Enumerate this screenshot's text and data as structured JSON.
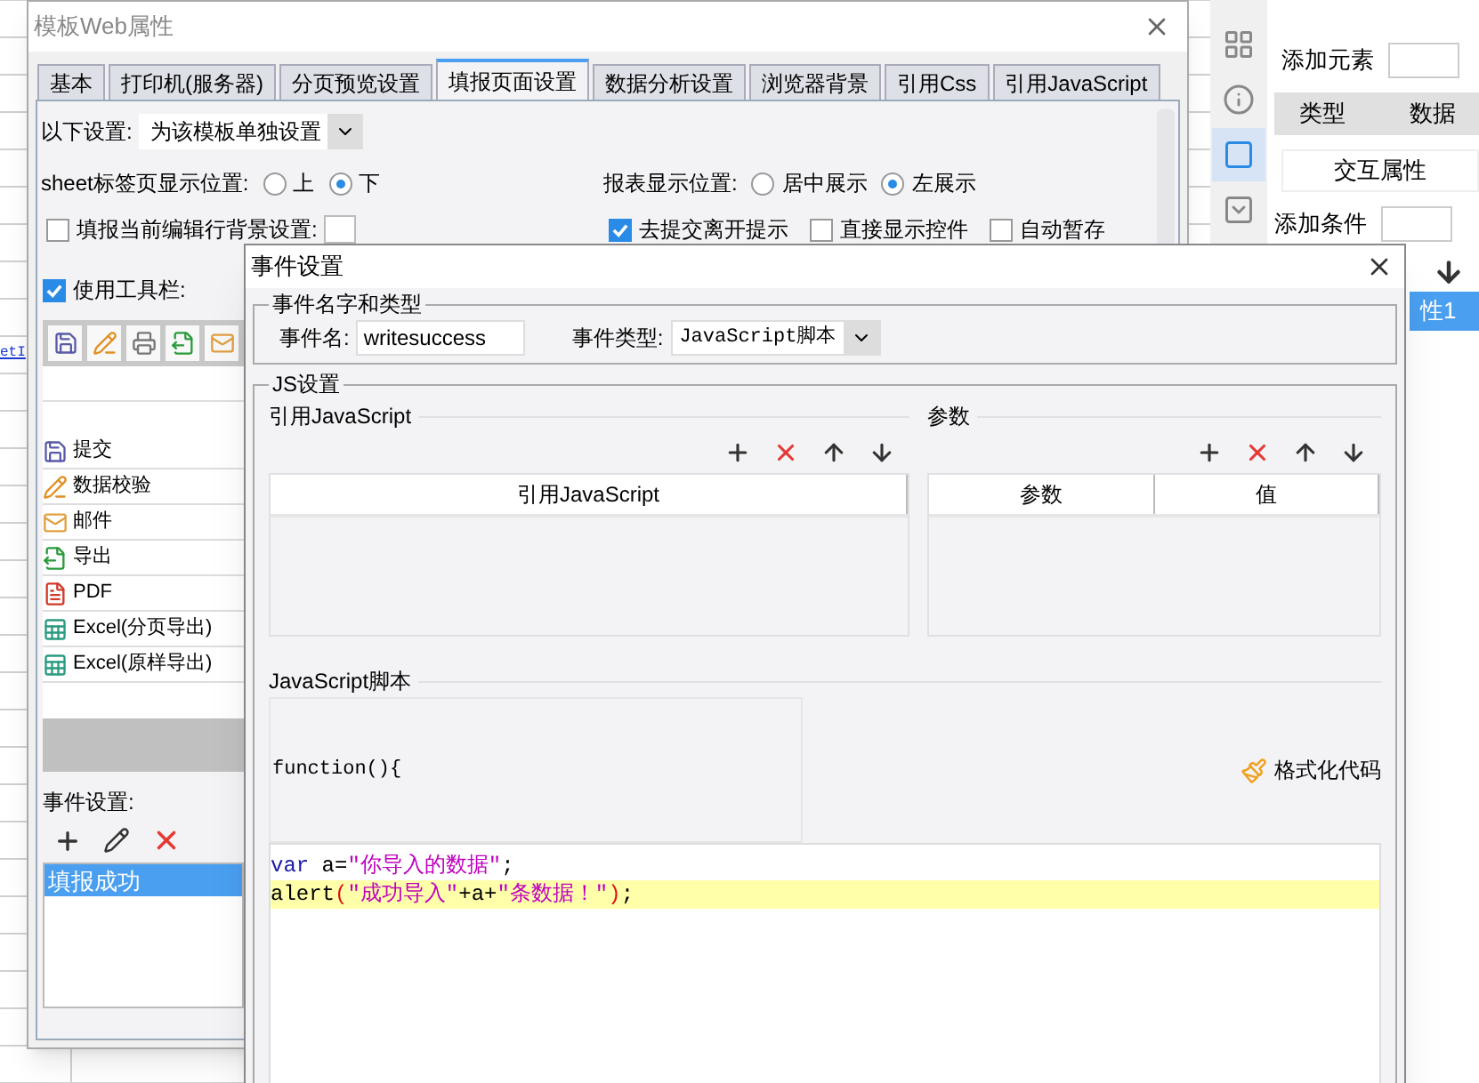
{
  "sheet_fragment": "etI",
  "right_panel": {
    "rail": [
      {
        "kind": "grid",
        "selected": false
      },
      {
        "kind": "info",
        "selected": false
      },
      {
        "kind": "frame",
        "selected": true
      },
      {
        "kind": "dropdown",
        "selected": false
      }
    ],
    "add_element": "添加元素",
    "columns": [
      "类型",
      "数据"
    ],
    "interaction": "交互属性",
    "add_condition": "添加条件",
    "items": [
      {
        "label": "性1",
        "selected": true
      }
    ]
  },
  "back_window": {
    "title": "模板Web属性",
    "tabs": [
      {
        "label": "基本",
        "selected": false
      },
      {
        "label": "打印机(服务器)",
        "selected": false
      },
      {
        "label": "分页预览设置",
        "selected": false
      },
      {
        "label": "填报页面设置",
        "selected": true
      },
      {
        "label": "数据分析设置",
        "selected": false
      },
      {
        "label": "浏览器背景",
        "selected": false
      },
      {
        "label": "引用Css",
        "selected": false
      },
      {
        "label": "引用JavaScript",
        "selected": false
      }
    ],
    "setting_label": "以下设置:",
    "setting_value": "为该模板单独设置",
    "sheet_position": {
      "label": "sheet标签页显示位置:",
      "options": [
        {
          "label": "上",
          "selected": false
        },
        {
          "label": "下",
          "selected": true
        }
      ]
    },
    "report_position": {
      "label": "报表显示位置:",
      "options": [
        {
          "label": "居中展示",
          "selected": false
        },
        {
          "label": "左展示",
          "selected": true
        }
      ]
    },
    "checkboxes": [
      {
        "label": "填报当前编辑行背景设置:",
        "checked": false
      },
      {
        "label": "去提交离开提示",
        "checked": true
      },
      {
        "label": "直接显示控件",
        "checked": false
      },
      {
        "label": "自动暂存",
        "checked": false
      }
    ],
    "toolbar_checkbox": {
      "label": "使用工具栏:",
      "checked": true
    },
    "toolbar_icons": [
      {
        "kind": "save"
      },
      {
        "kind": "check"
      },
      {
        "kind": "print"
      },
      {
        "kind": "export"
      },
      {
        "kind": "mail"
      }
    ],
    "buttons": [
      {
        "kind": "save",
        "label": "提交"
      },
      {
        "kind": "check",
        "label": "数据校验"
      },
      {
        "kind": "mail",
        "label": "邮件"
      },
      {
        "kind": "export",
        "label": "导出"
      },
      {
        "kind": "pdf",
        "label": "PDF"
      },
      {
        "kind": "excel",
        "label": "Excel(分页导出)"
      },
      {
        "kind": "excel",
        "label": "Excel(原样导出)"
      }
    ],
    "event_label": "事件设置:",
    "events": [
      {
        "label": "填报成功",
        "selected": true
      }
    ]
  },
  "dialog": {
    "title": "事件设置",
    "name_group": {
      "title": "事件名字和类型",
      "name_label": "事件名:",
      "name_value": "writesuccess",
      "type_label": "事件类型:",
      "type_value": "JavaScript脚本"
    },
    "js_group": {
      "title": "JS设置",
      "references": {
        "title": "引用JavaScript",
        "columns": [
          "引用JavaScript"
        ]
      },
      "params": {
        "title": "参数",
        "columns": [
          "参数",
          "值"
        ]
      },
      "script": {
        "title": "JavaScript脚本",
        "header": "function(){",
        "format_button": "格式化代码",
        "lines": [
          {
            "highlighted": false,
            "tokens": [
              {
                "kind": "keyword",
                "text": "var"
              },
              {
                "kind": "plain",
                "text": " a="
              },
              {
                "kind": "string",
                "text": "\"你导入的数据\""
              },
              {
                "kind": "plain",
                "text": ";"
              }
            ]
          },
          {
            "highlighted": true,
            "tokens": [
              {
                "kind": "plain",
                "text": "alert"
              },
              {
                "kind": "paren",
                "text": "("
              },
              {
                "kind": "string",
                "text": "\"成功导入\""
              },
              {
                "kind": "plain",
                "text": "+a+"
              },
              {
                "kind": "string",
                "text": "\"条数据！\""
              },
              {
                "kind": "paren",
                "text": ")"
              },
              {
                "kind": "plain",
                "text": ";"
              }
            ]
          }
        ]
      }
    }
  }
}
